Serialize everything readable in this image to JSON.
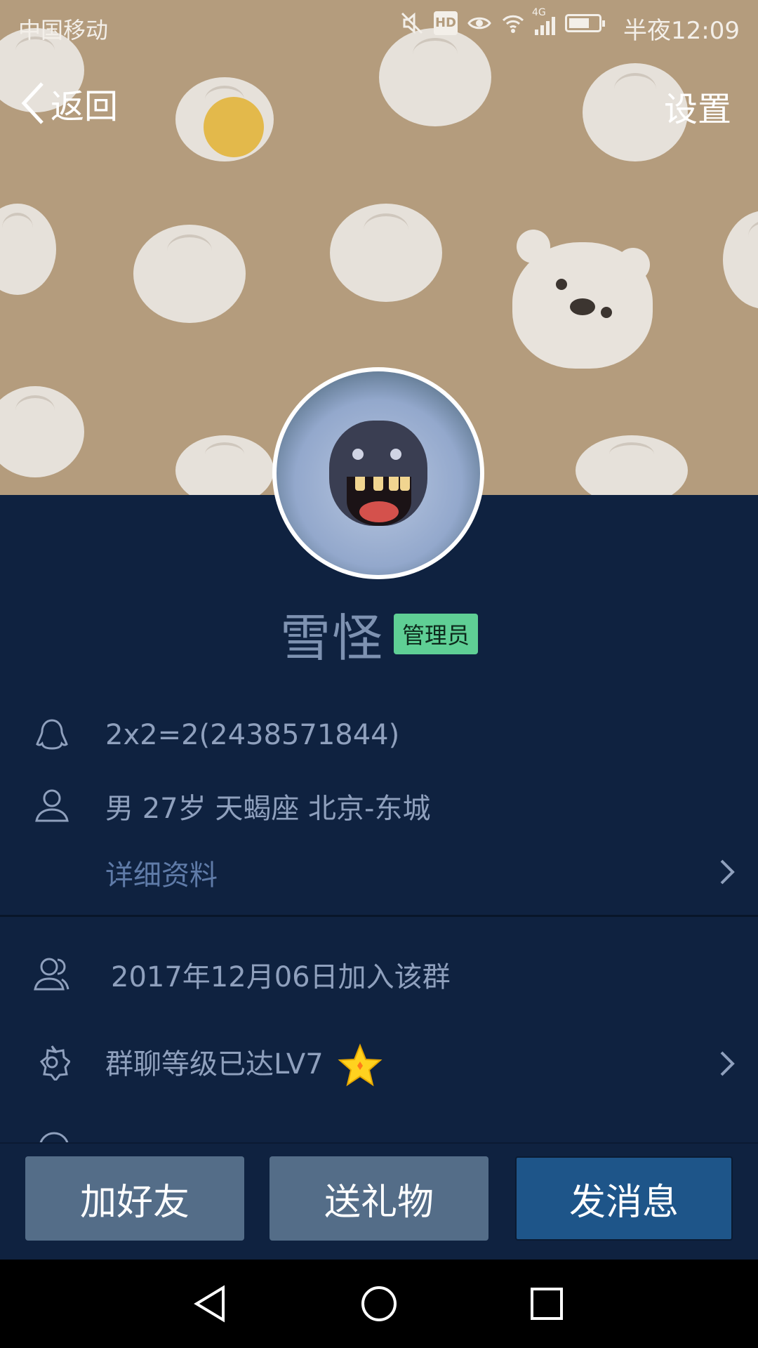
{
  "status_bar": {
    "carrier": "中国移动",
    "clock": "半夜12:09",
    "icons": [
      "mute-icon",
      "hd-icon",
      "eye-icon",
      "wifi-icon",
      "4g-signal-icon",
      "battery-icon"
    ],
    "network": "4G",
    "hd": "HD"
  },
  "nav": {
    "back_label": "返回",
    "settings_label": "设置"
  },
  "profile": {
    "name": "雪怪",
    "role": "管理员"
  },
  "info": {
    "qq": "2x2=2(2438571844)",
    "details": "男  27岁  天蝎座  北京-东城",
    "more_label": "详细资料",
    "joined": "2017年12月06日加入该群",
    "level": "群聊等级已达LV7"
  },
  "actions": {
    "add_friend": "加好友",
    "send_gift": "送礼物",
    "send_message": "发消息"
  },
  "colors": {
    "banner": "#b49c7d",
    "page_bg": "#0f2240",
    "badge": "#5fcf95",
    "primary_button": "#1e5589",
    "secondary_button": "#546d88"
  }
}
